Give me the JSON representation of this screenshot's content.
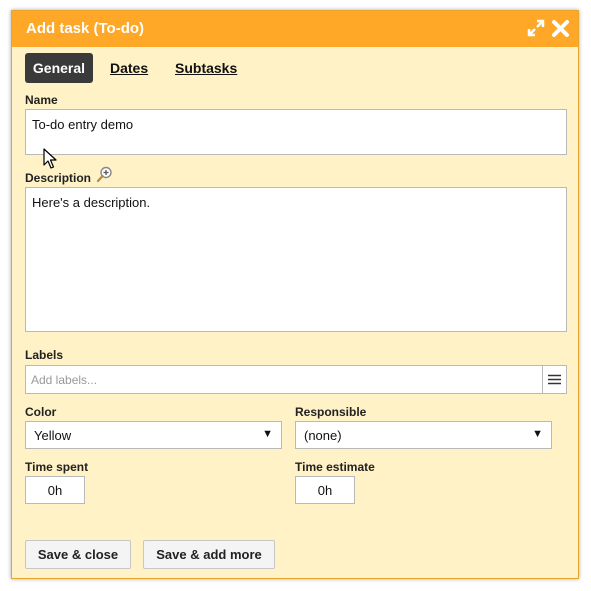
{
  "dialog": {
    "title": "Add task (To-do)",
    "icons": {
      "expand": "expand-icon",
      "close": "close-icon",
      "zoom": "magnifier-plus-icon",
      "menu": "hamburger-icon"
    }
  },
  "tabs": [
    {
      "label": "General",
      "active": true
    },
    {
      "label": "Dates",
      "active": false
    },
    {
      "label": "Subtasks",
      "active": false
    }
  ],
  "form": {
    "name": {
      "label": "Name",
      "value": "To-do entry demo"
    },
    "description": {
      "label": "Description",
      "value": "Here's a description."
    },
    "labels": {
      "label": "Labels",
      "placeholder": "Add labels..."
    },
    "color": {
      "label": "Color",
      "value": "Yellow"
    },
    "responsible": {
      "label": "Responsible",
      "value": "(none)"
    },
    "time_spent": {
      "label": "Time spent",
      "value": "0h"
    },
    "time_estimate": {
      "label": "Time estimate",
      "value": "0h"
    }
  },
  "buttons": {
    "save_close": "Save & close",
    "save_add_more": "Save & add more"
  },
  "colors": {
    "titlebar": "#ffa726",
    "panel": "#fff2c6",
    "active_tab": "#3a3a3a"
  }
}
